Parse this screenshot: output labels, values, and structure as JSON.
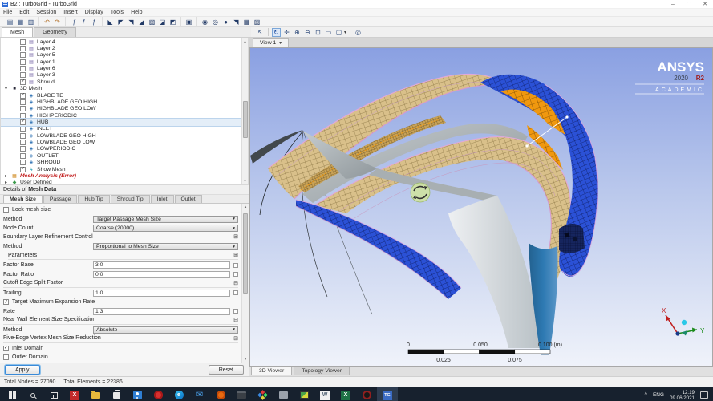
{
  "colors": {
    "viewport_top": "#8aa0e2",
    "viewport_bottom": "#f0f3fa",
    "mesh_tan": "#d9c08a",
    "mesh_blue": "#2b51d6",
    "mesh_orange": "#f0980f",
    "steel_blade": "#2d74aa",
    "ansys_red": "#a02020",
    "taskbar_bg": "#17212e",
    "selection_highlight": "#e4eef8",
    "error_text": "#c01818"
  },
  "glyphs": {
    "check": "✓",
    "caret_down": "▾",
    "caret_right": "▸",
    "dropdown": "▾",
    "expand": "⊞",
    "collapse": "⊟",
    "scroll_up": "▴",
    "scroll_down": "▾",
    "minimize": "–",
    "maximize": "▢",
    "close": "✕",
    "tray_chevron": "^",
    "mail": "✉"
  },
  "window": {
    "title": "B2 : TurboGrid - TurboGrid"
  },
  "menu": {
    "items": [
      "File",
      "Edit",
      "Session",
      "Insert",
      "Display",
      "Tools",
      "Help"
    ]
  },
  "toolbar": {
    "icons": [
      {
        "name": "save",
        "glyph": "▤"
      },
      {
        "name": "save-state",
        "glyph": "▦"
      },
      {
        "name": "print",
        "glyph": "▥"
      },
      {
        "name": "undo",
        "glyph": "↶"
      },
      {
        "name": "redo",
        "glyph": "↷"
      },
      {
        "name": "insert-point",
        "glyph": "·ƒ"
      },
      {
        "name": "insert-curve",
        "glyph": "ƒ"
      },
      {
        "name": "insert-surface",
        "glyph": "ƒ"
      },
      {
        "name": "transform-rotate",
        "glyph": "◣"
      },
      {
        "name": "transform-plane-1",
        "glyph": "◤"
      },
      {
        "name": "transform-plane-2",
        "glyph": "◥"
      },
      {
        "name": "tag",
        "glyph": "◢"
      },
      {
        "name": "instance",
        "glyph": "▧"
      },
      {
        "name": "surface-tool",
        "glyph": "◪"
      },
      {
        "name": "volume-tool",
        "glyph": "◩"
      },
      {
        "name": "copy",
        "glyph": "▣"
      },
      {
        "name": "machine-sphere-1",
        "glyph": "◉"
      },
      {
        "name": "machine-sphere-2",
        "glyph": "◎"
      },
      {
        "name": "machine-sphere-3",
        "glyph": "●"
      },
      {
        "name": "turbo-surface",
        "glyph": "◥"
      },
      {
        "name": "turbo-report-1",
        "glyph": "▦"
      },
      {
        "name": "turbo-report-2",
        "glyph": "▨"
      }
    ]
  },
  "workspace_tabs": {
    "mesh": "Mesh",
    "geometry": "Geometry"
  },
  "tree": {
    "items": [
      {
        "label": "Layer 4"
      },
      {
        "label": "Layer 2"
      },
      {
        "label": "Layer 5"
      },
      {
        "label": "Layer 1"
      },
      {
        "label": "Layer 6"
      },
      {
        "label": "Layer 3"
      },
      {
        "label": "Shroud"
      },
      {
        "label": "3D Mesh"
      },
      {
        "label": "BLADE TE"
      },
      {
        "label": "HIGHBLADE GEO HIGH"
      },
      {
        "label": "HIGHBLADE GEO LOW"
      },
      {
        "label": "HIGHPERIODIC"
      },
      {
        "label": "HUB"
      },
      {
        "label": "INLET"
      },
      {
        "label": "LOWBLADE GEO HIGH"
      },
      {
        "label": "LOWBLADE GEO LOW"
      },
      {
        "label": "LOWPERIODIC"
      },
      {
        "label": "OUTLET"
      },
      {
        "label": "SHROUD"
      },
      {
        "label": "Show Mesh"
      },
      {
        "label": "Mesh Analysis (Error)"
      },
      {
        "label": "User Defined"
      }
    ]
  },
  "details": {
    "header_prefix": "Details of",
    "header_name": "Mesh Data",
    "tabs": {
      "t0": "Mesh Size",
      "t1": "Passage",
      "t2": "Hub Tip",
      "t3": "Shroud Tip",
      "t4": "Inlet",
      "t5": "Outlet"
    }
  },
  "form": {
    "lock_mesh_size": {
      "label": "Lock mesh size"
    },
    "method_top": {
      "label": "Method",
      "value": "Target Passage Mesh Size"
    },
    "node_count": {
      "label": "Node Count",
      "value": "Coarse (20000)"
    },
    "blrc": {
      "label": "Boundary Layer Refinement Control"
    },
    "method_blrc": {
      "label": "Method",
      "value": "Proportional to Mesh Size"
    },
    "parameters": {
      "label": "Parameters"
    },
    "factor_base": {
      "label": "Factor Base",
      "value": "3.0"
    },
    "factor_ratio": {
      "label": "Factor Ratio",
      "value": "0.0"
    },
    "cutoff": {
      "label": "Cutoff Edge Split Factor"
    },
    "trailing": {
      "label": "Trailing",
      "value": "1.0"
    },
    "target_max_exp": {
      "label": "Target Maximum Expansion Rate"
    },
    "rate": {
      "label": "Rate",
      "value": "1.3"
    },
    "near_wall": {
      "label": "Near Wall Element Size Specification"
    },
    "method_near_wall": {
      "label": "Method",
      "value": "Absolute"
    },
    "five_edge": {
      "label": "Five-Edge Vertex Mesh Size Reduction"
    },
    "inlet_domain": {
      "label": "Inlet Domain"
    },
    "outlet_domain": {
      "label": "Outlet Domain"
    }
  },
  "actions": {
    "apply": "Apply",
    "reset": "Reset"
  },
  "viewer": {
    "view_tab": "View 1",
    "bottom_tabs": {
      "viewer3d": "3D Viewer",
      "topology": "Topology Viewer"
    },
    "logo": {
      "brand": "ANSYS",
      "version_year": "2020",
      "version_release": "R2",
      "edition": "ACADEMIC"
    },
    "ruler": {
      "t0": "0",
      "t1": "0.050",
      "t2": "0.100 (m)",
      "b0": "0.025",
      "b1": "0.075"
    },
    "triad": {
      "x": "X",
      "y": "Y"
    }
  },
  "status": {
    "nodes": "Total Nodes = 27090",
    "elements": "Total Elements = 22386"
  },
  "taskbar": {
    "icons": [
      "start",
      "search",
      "task-view",
      "adobe-red",
      "file-explorer",
      "store",
      "skype",
      "opera",
      "edge",
      "mail",
      "firefox",
      "terminal",
      "diamond-app",
      "gray-app",
      "photos",
      "word",
      "excel",
      "recorder",
      "turbogrid"
    ],
    "labels": {
      "adobe": "X",
      "edge": "e",
      "word": "W",
      "excel": "X",
      "turbogrid": "TG"
    }
  },
  "tray": {
    "lang": "ENG",
    "time": "12:19",
    "date": "09.06.2021"
  }
}
